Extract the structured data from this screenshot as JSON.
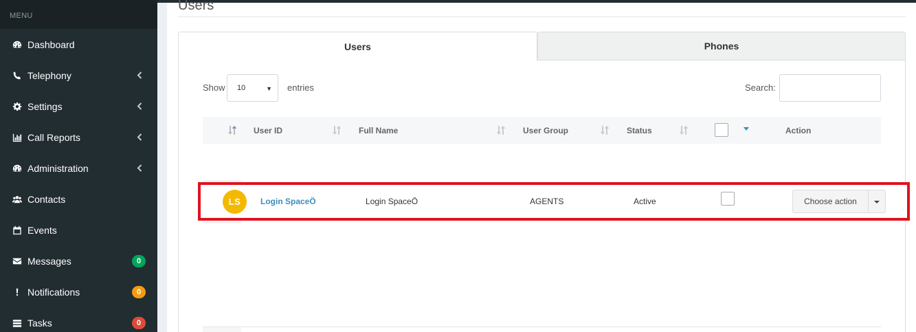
{
  "sidebar": {
    "header": "MENU",
    "items": [
      {
        "label": "Dashboard",
        "icon": "dashboard-icon"
      },
      {
        "label": "Telephony",
        "icon": "phone-icon",
        "expandable": true
      },
      {
        "label": "Settings",
        "icon": "gear-icon",
        "expandable": true
      },
      {
        "label": "Call Reports",
        "icon": "bar-chart-icon",
        "expandable": true
      },
      {
        "label": "Administration",
        "icon": "dashboard-icon",
        "expandable": true
      },
      {
        "label": "Contacts",
        "icon": "users-icon"
      },
      {
        "label": "Events",
        "icon": "calendar-icon"
      },
      {
        "label": "Messages",
        "icon": "envelope-icon",
        "badge": "0",
        "badge_color": "#00a65a"
      },
      {
        "label": "Notifications",
        "icon": "exclamation-icon",
        "badge": "0",
        "badge_color": "#f39c12"
      },
      {
        "label": "Tasks",
        "icon": "tasks-icon",
        "badge": "0",
        "badge_color": "#dd4b39"
      }
    ]
  },
  "page": {
    "title": "Users"
  },
  "tabs": [
    {
      "label": "Users",
      "active": true
    },
    {
      "label": "Phones",
      "active": false
    }
  ],
  "controls": {
    "show_label": "Show",
    "entries_value": "10",
    "entries_label": "entries",
    "search_label": "Search:",
    "search_value": ""
  },
  "table": {
    "columns": [
      "User ID",
      "Full Name",
      "User Group",
      "Status",
      "Action"
    ],
    "rows": [
      {
        "avatar_initials": "LS",
        "avatar_color": "#f5b800",
        "user_id": "Login SpaceÖ",
        "full_name": "Login SpaceÖ",
        "user_group": "AGENTS",
        "status": "Active",
        "action": "Choose action"
      }
    ]
  },
  "colors": {
    "sidebar_bg": "#222d32",
    "link": "#3c8dbc",
    "highlight_border": "#e0121f"
  }
}
